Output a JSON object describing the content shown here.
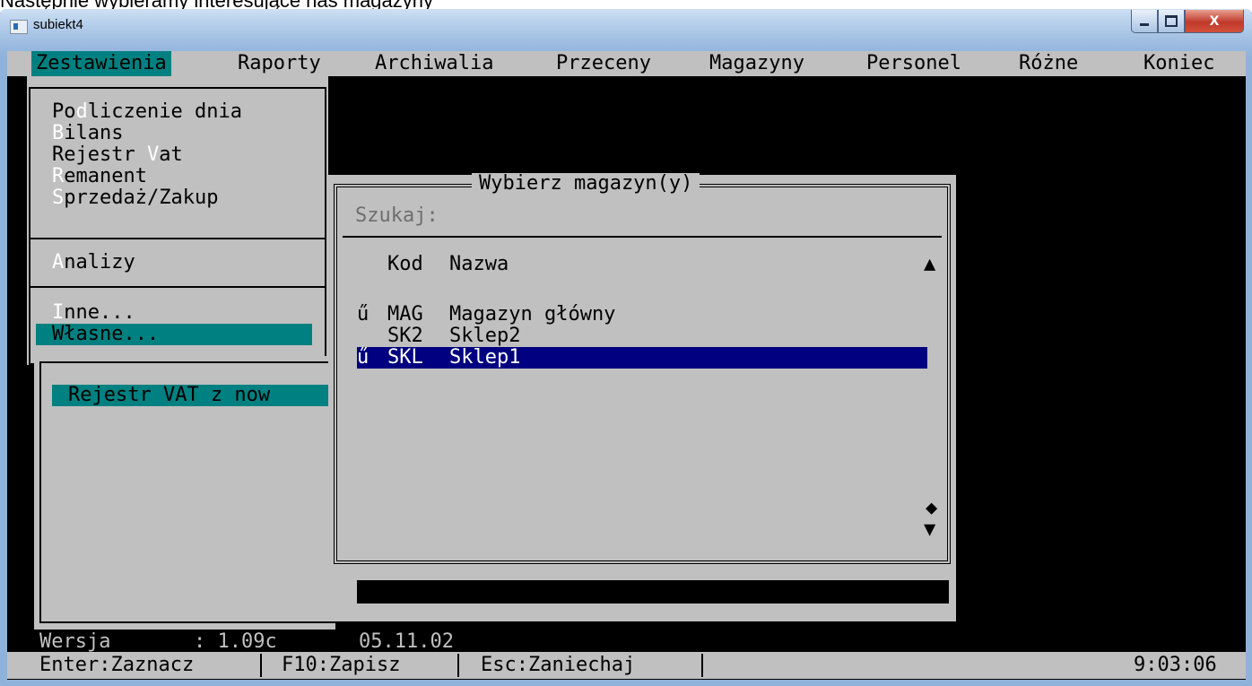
{
  "caption": "Następnie wybieramy interesujące nas magazyny",
  "window": {
    "title": "subiekt4",
    "minimize": "—",
    "close": "X"
  },
  "menu": [
    "Zestawienia",
    "Raporty",
    "Archiwalia",
    "Przeceny",
    "Magazyny",
    "Personel",
    "Różne",
    "Koniec"
  ],
  "submenu": {
    "group1": [
      {
        "before": "Po",
        "hot": "d",
        "after": "liczenie dnia"
      },
      {
        "before": "",
        "hot": "B",
        "after": "ilans"
      },
      {
        "before": "Rejestr ",
        "hot": "V",
        "after": "at"
      },
      {
        "before": "",
        "hot": "R",
        "after": "emanent"
      },
      {
        "before": "",
        "hot": "S",
        "after": "przedaż/Zakup"
      }
    ],
    "group2": [
      {
        "before": "",
        "hot": "A",
        "after": "nalizy"
      }
    ],
    "group3": [
      {
        "before": "",
        "hot": "I",
        "after": "nne..."
      },
      {
        "text": "Własne..."
      }
    ]
  },
  "background_panel": {
    "selected_item": "Rejestr VAT z now"
  },
  "dialog": {
    "title": "Wybierz magazyn(y)",
    "search_label": "Szukaj:",
    "columns": [
      "Kod",
      "Nazwa"
    ],
    "rows": [
      {
        "mark": "ű",
        "code": "MAG",
        "name": "Magazyn główny",
        "selected": false
      },
      {
        "mark": "",
        "code": "SK2",
        "name": "Sklep2",
        "selected": false
      },
      {
        "mark": "ű",
        "code": "SKL",
        "name": "Sklep1",
        "selected": true
      }
    ],
    "scroll_up": "▲",
    "scroll_thumb": "◆",
    "scroll_down": "▼"
  },
  "version": {
    "label": "Wersja",
    "value": ": 1.09c",
    "date": "05.11.02"
  },
  "status": {
    "enter": "Enter:Zaznacz",
    "f10": "F10:Zapisz",
    "esc": "Esc:Zaniechaj",
    "clock": "9:03:06"
  },
  "colors": {
    "menu_bg": "#c0c0c0",
    "active": "#008080",
    "selection": "#000080",
    "console_bg": "#000000"
  }
}
